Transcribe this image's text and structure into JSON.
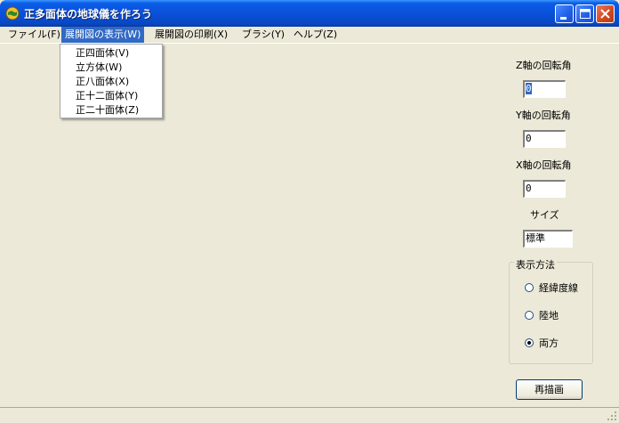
{
  "window": {
    "title": "正多面体の地球儀を作ろう"
  },
  "menubar": {
    "items": [
      {
        "label": "ファイル(F)"
      },
      {
        "label": "展開図の表示(W)"
      },
      {
        "label": "展開図の印刷(X)"
      },
      {
        "label": "ブラシ(Y)"
      },
      {
        "label": "ヘルプ(Z)"
      }
    ]
  },
  "dropdown": {
    "items": [
      {
        "label": "正四面体(V)"
      },
      {
        "label": "立方体(W)"
      },
      {
        "label": "正八面体(X)"
      },
      {
        "label": "正十二面体(Y)"
      },
      {
        "label": "正二十面体(Z)"
      }
    ]
  },
  "panel": {
    "z_label": "Z軸の回転角",
    "z_value": "0",
    "y_label": "Y軸の回転角",
    "y_value": "0",
    "x_label": "X軸の回転角",
    "x_value": "0",
    "size_label": "サイズ",
    "size_value": "標準",
    "display": {
      "title": "表示方法",
      "options": [
        {
          "label": "経緯度線",
          "checked": false
        },
        {
          "label": "陸地",
          "checked": false
        },
        {
          "label": "両方",
          "checked": true
        }
      ]
    },
    "redraw_label": "再描画"
  },
  "colors": {
    "titlebar": "#0a50d8",
    "menu_highlight": "#316ac5",
    "face": "#ece9d8"
  }
}
